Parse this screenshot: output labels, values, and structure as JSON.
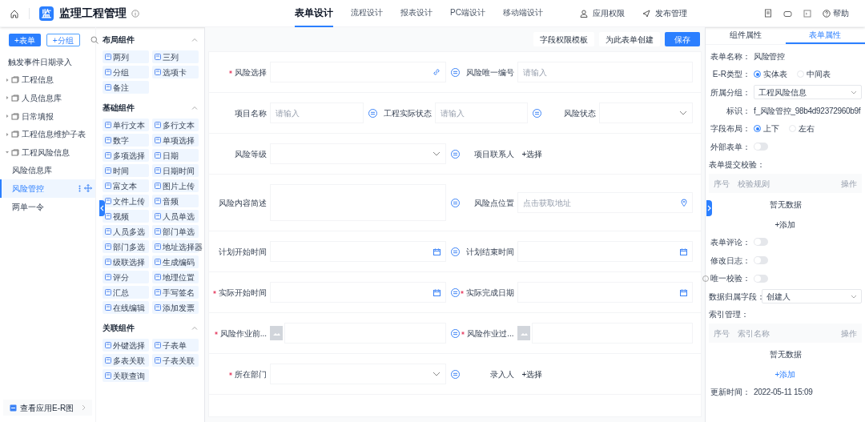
{
  "header": {
    "logo": "监",
    "title": "监理工程管理",
    "tabs": [
      {
        "label": "表单设计",
        "selected": true
      },
      {
        "label": "流程设计",
        "selected": false
      },
      {
        "label": "报表设计",
        "selected": false
      },
      {
        "label": "PC端设计",
        "selected": false
      },
      {
        "label": "移动端设计",
        "selected": false
      }
    ],
    "actions": [
      {
        "label": "应用权限",
        "kind": "permission"
      },
      {
        "label": "发布管理",
        "kind": "publish"
      }
    ],
    "help": "帮助"
  },
  "sidebar": {
    "buttons": [
      {
        "label": "+表单",
        "primary": true
      },
      {
        "label": "+分组",
        "primary": false
      }
    ],
    "tree": [
      {
        "label": "触发事件日期录入",
        "kind": "form",
        "selected": false
      },
      {
        "label": "工程信息",
        "kind": "group",
        "expanded": false,
        "selected": false
      },
      {
        "label": "人员信息库",
        "kind": "group",
        "expanded": false,
        "selected": false
      },
      {
        "label": "日常填报",
        "kind": "group",
        "expanded": false,
        "selected": false
      },
      {
        "label": "工程信息维护子表",
        "kind": "group",
        "expanded": false,
        "selected": false
      },
      {
        "label": "工程风险信息",
        "kind": "group",
        "expanded": true,
        "selected": false,
        "children": [
          {
            "label": "风险信息库",
            "kind": "form",
            "selected": false
          },
          {
            "label": "风险管控",
            "kind": "form",
            "selected": true
          },
          {
            "label": "两单一令",
            "kind": "form",
            "selected": false
          }
        ]
      }
    ],
    "footer": "查看应用E-R图"
  },
  "components": [
    {
      "title": "布局组件",
      "expanded": true,
      "items": [
        "两列",
        "三列",
        "分组",
        "选项卡",
        "备注"
      ]
    },
    {
      "title": "基础组件",
      "expanded": true,
      "items": [
        "单行文本",
        "多行文本",
        "数字",
        "单项选择",
        "多项选择",
        "日期",
        "时间",
        "日期时间",
        "富文本",
        "图片上传",
        "文件上传",
        "音频",
        "视频",
        "人员单选",
        "人员多选",
        "部门单选",
        "部门多选",
        "地址选择器",
        "级联选择",
        "生成编码",
        "评分",
        "地理位置",
        "汇总",
        "手写签名",
        "在线编辑",
        "添加发票"
      ]
    },
    {
      "title": "关联组件",
      "expanded": true,
      "items": [
        "外键选择",
        "子表单",
        "多表关联",
        "子表关联",
        "关联查询"
      ]
    }
  ],
  "toolbar": [
    {
      "label": "字段权限模板",
      "primary": false
    },
    {
      "label": "为此表单创建",
      "primary": false
    },
    {
      "label": "保存",
      "primary": true
    }
  ],
  "form": {
    "rows": [
      {
        "fields": [
          {
            "label": "风险选择",
            "required": true,
            "kind": "link"
          },
          {
            "label": "风险唯一编号",
            "required": false,
            "kind": "input",
            "placeholder": "请输入"
          }
        ]
      },
      {
        "fields": [
          {
            "label": "项目名称",
            "required": false,
            "kind": "input",
            "placeholder": "请输入"
          },
          {
            "label": "工程实际状态",
            "required": false,
            "kind": "input",
            "placeholder": "请输入"
          },
          {
            "label": "风险状态",
            "required": false,
            "kind": "select"
          }
        ]
      },
      {
        "fields": [
          {
            "label": "风险等级",
            "required": false,
            "kind": "select"
          },
          {
            "label": "项目联系人",
            "required": false,
            "kind": "person",
            "value": "+选择"
          }
        ]
      },
      {
        "fields": [
          {
            "label": "风险内容简述",
            "required": false,
            "kind": "textarea"
          },
          {
            "label": "风险点位置",
            "required": false,
            "kind": "location",
            "placeholder": "点击获取地址"
          }
        ]
      },
      {
        "fields": [
          {
            "label": "计划开始时间",
            "required": false,
            "kind": "date"
          },
          {
            "label": "计划结束时间",
            "required": false,
            "kind": "date"
          }
        ]
      },
      {
        "fields": [
          {
            "label": "实际开始时间",
            "required": true,
            "kind": "date"
          },
          {
            "label": "实际完成日期",
            "required": true,
            "kind": "date"
          }
        ]
      },
      {
        "fields": [
          {
            "label": "风险作业前...",
            "required": true,
            "kind": "image"
          },
          {
            "label": "风险作业过...",
            "required": true,
            "kind": "image"
          }
        ]
      },
      {
        "fields": [
          {
            "label": "所在部门",
            "required": true,
            "kind": "select"
          },
          {
            "label": "录入人",
            "required": false,
            "kind": "person",
            "value": "+选择"
          }
        ]
      }
    ]
  },
  "properties": {
    "tabs": [
      {
        "label": "组件属性",
        "selected": false
      },
      {
        "label": "表单属性",
        "selected": true
      }
    ],
    "rows": [
      {
        "kind": "text",
        "label": "表单名称：",
        "value": "风险管控"
      },
      {
        "kind": "radio",
        "label": "E-R类型：",
        "options": [
          {
            "label": "实体表",
            "selected": true
          },
          {
            "label": "中间表",
            "selected": false
          }
        ]
      },
      {
        "kind": "select",
        "label": "所属分组：",
        "value": "工程风险信息"
      },
      {
        "kind": "text",
        "label": "标识：",
        "value": "f_风险管控_98b4d92372960b9f"
      },
      {
        "kind": "radio",
        "label": "字段布局：",
        "options": [
          {
            "label": "上下",
            "selected": true
          },
          {
            "label": "左右",
            "selected": false
          }
        ]
      },
      {
        "kind": "toggle",
        "label": "外部表单：",
        "on": false
      },
      {
        "kind": "heading",
        "label": "表单提交校验："
      },
      {
        "kind": "table",
        "columns": [
          "序号",
          "校验规则",
          "操作"
        ],
        "empty": "暂无数据",
        "add": "+添加"
      },
      {
        "kind": "toggle",
        "label": "表单评论：",
        "on": false
      },
      {
        "kind": "toggle",
        "label": "修改日志：",
        "on": false
      },
      {
        "kind": "toggle",
        "label": "唯一校验：",
        "on": false,
        "help": true
      },
      {
        "kind": "select",
        "label": "数据归属字段：",
        "value": "创建人"
      },
      {
        "kind": "heading",
        "label": "索引管理："
      },
      {
        "kind": "table",
        "columns": [
          "序号",
          "索引名称",
          "操作"
        ],
        "empty": "暂无数据",
        "add": "+添加"
      },
      {
        "kind": "text",
        "label": "更新时间：",
        "value": "2022-05-11 15:09"
      }
    ]
  }
}
